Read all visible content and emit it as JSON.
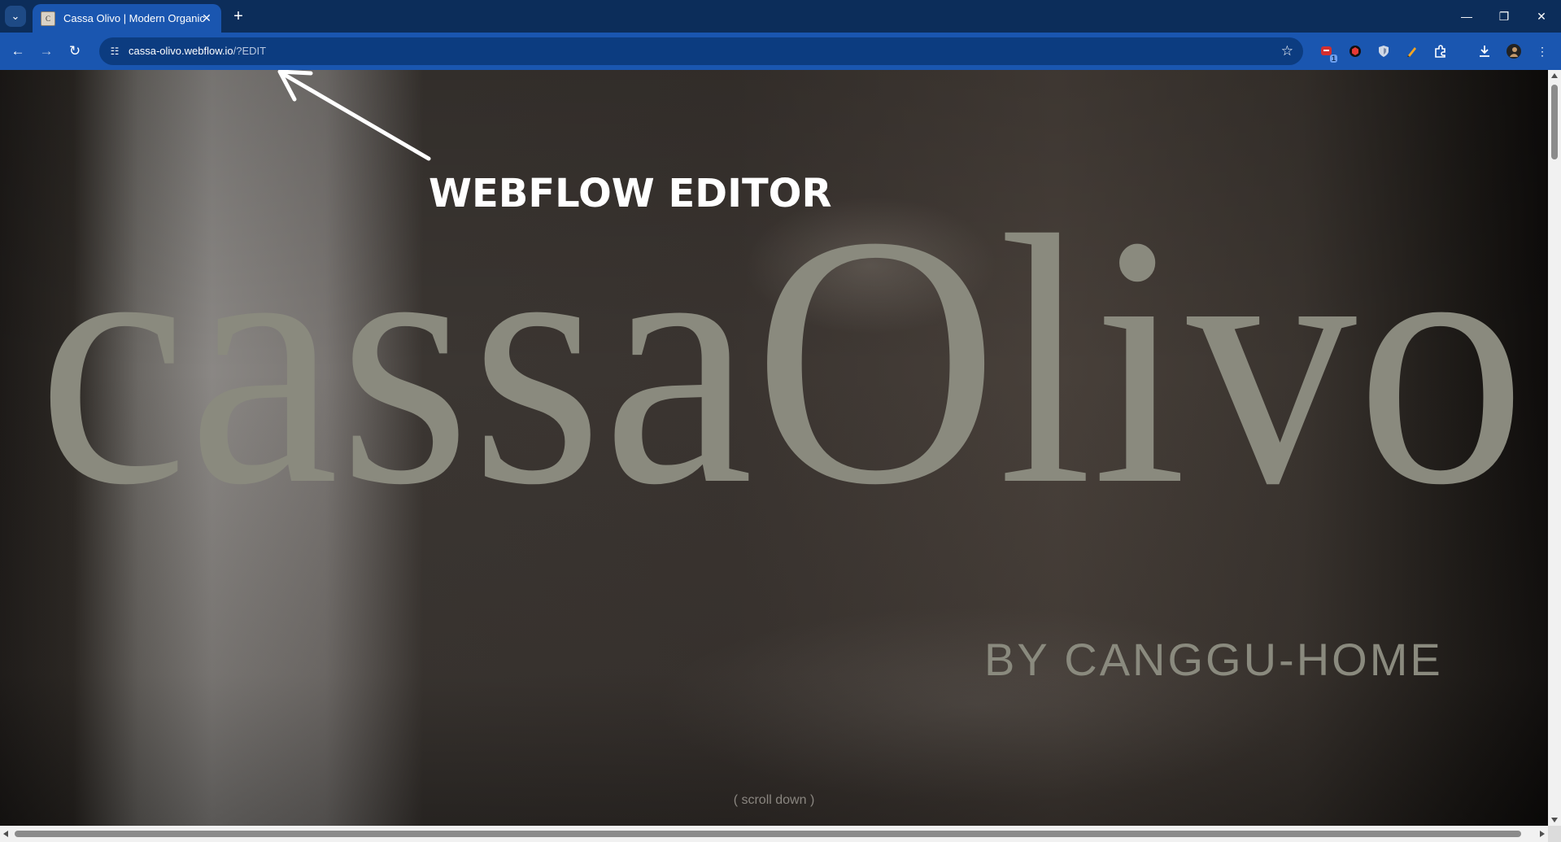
{
  "browser": {
    "tab": {
      "title": "Cassa Olivo | Modern Organic I",
      "favicon": "site-favicon"
    },
    "url": {
      "host": "cassa-olivo.webflow.io",
      "path": "/?EDIT"
    },
    "extensions": [
      {
        "name": "extension-red-icon",
        "badge": "1"
      },
      {
        "name": "extension-cube-icon"
      },
      {
        "name": "extension-shield-icon"
      },
      {
        "name": "extension-pen-icon"
      },
      {
        "name": "extensions-puzzle-icon"
      }
    ]
  },
  "page": {
    "brand_name": "cassaOlivo",
    "brand_sub": "BY CANGGU-HOME",
    "scroll_hint": "( scroll down )"
  },
  "annotation": {
    "label": "WEBFLOW EDITOR"
  },
  "colors": {
    "tab_strip": "#0c2d5a",
    "toolbar": "#1a56b0",
    "brand_text": "#8a8a7e"
  }
}
